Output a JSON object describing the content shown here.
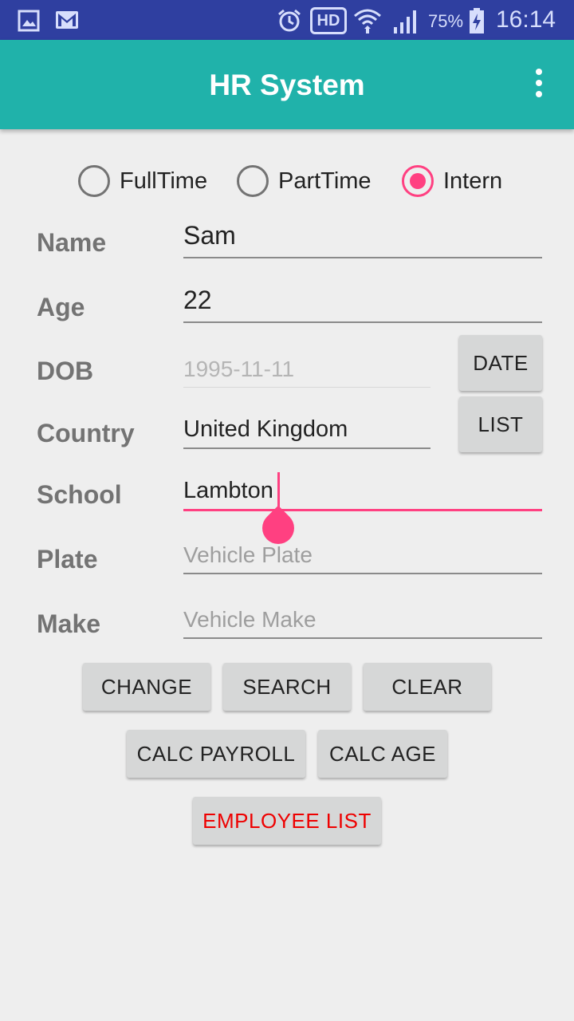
{
  "status_bar": {
    "left_icons": [
      "gallery-icon",
      "gmail-icon"
    ],
    "right_icons": [
      "alarm-icon",
      "hd-icon",
      "wifi-icon",
      "signal-icon",
      "battery-charging-icon"
    ],
    "hd_label": "HD",
    "battery_percent": "75%",
    "time": "16:14"
  },
  "app_bar": {
    "title": "HR System",
    "menu_icon": "overflow-menu-icon",
    "color": "#20b2aa"
  },
  "employment_type": {
    "options": [
      {
        "label": "FullTime",
        "checked": false
      },
      {
        "label": "PartTime",
        "checked": false
      },
      {
        "label": "Intern",
        "checked": true
      }
    ],
    "accent": "#ff4081"
  },
  "form": {
    "name": {
      "label": "Name",
      "value": "Sam"
    },
    "age": {
      "label": "Age",
      "value": "22"
    },
    "dob": {
      "label": "DOB",
      "value": "1995-11-11"
    },
    "country": {
      "label": "Country",
      "value": "United Kingdom"
    },
    "school": {
      "label": "School",
      "value": "Lambton"
    },
    "plate": {
      "label": "Plate",
      "value": "",
      "placeholder": "Vehicle Plate"
    },
    "make": {
      "label": "Make",
      "value": "",
      "placeholder": "Vehicle Make"
    }
  },
  "side_buttons": {
    "date": "DATE",
    "list": "LIST"
  },
  "actions": {
    "change": "CHANGE",
    "search": "SEARCH",
    "clear": "CLEAR",
    "calc_payroll": "CALC PAYROLL",
    "calc_age": "CALC AGE",
    "employee_list": "EMPLOYEE LIST",
    "employee_list_color": "#ee0000"
  }
}
